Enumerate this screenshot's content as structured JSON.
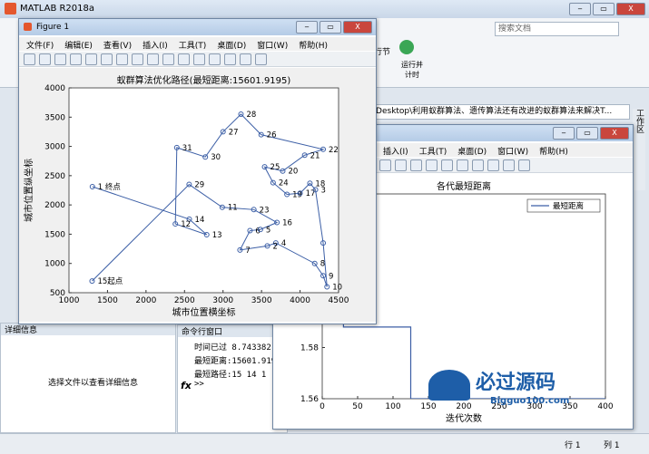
{
  "app": {
    "title": "MATLAB R2018a",
    "search_placeholder": "搜索文档",
    "run_label": "运行并\n计时",
    "section_label": "行节"
  },
  "address_path": "\\Desktop\\利用蚁群算法、遗传算法还有改进的蚁群算法来解决T...",
  "side_tab": "工作区",
  "left_panel": {
    "header": "详细信息",
    "message": "选择文件以查看详细信息"
  },
  "command_window": {
    "title": "命令行窗口",
    "lines": [
      "时间已过 8.743382",
      "最短距离:15601.919",
      "最短路径:15   14   1"
    ],
    "prompt": ">>",
    "fx": "fx"
  },
  "figure1": {
    "title": "Figure 1",
    "menu": [
      "文件(F)",
      "编辑(E)",
      "查看(V)",
      "插入(I)",
      "工具(T)",
      "桌面(D)",
      "窗口(W)",
      "帮助(H)"
    ],
    "window_buttons": [
      "‒",
      "▭",
      "X"
    ]
  },
  "figure2": {
    "menu": [
      "插入(I)",
      "工具(T)",
      "桌面(D)",
      "窗口(W)",
      "帮助(H)"
    ],
    "window_buttons": [
      "‒",
      "▭",
      "X"
    ]
  },
  "status_bar": {
    "row": "行 1",
    "col": "列 1"
  },
  "watermark": {
    "text": "必过源码",
    "url": "Bigguo100.com"
  },
  "colors": {
    "line": "#3c5fa6",
    "accent": "#1e5ea8"
  },
  "chart_data": [
    {
      "type": "line",
      "title": "蚁群算法优化路径(最短距离:15601.9195)",
      "xlabel": "城市位置横坐标",
      "ylabel": "城市位置纵坐标",
      "xlim": [
        1000,
        4500
      ],
      "ylim": [
        500,
        4000
      ],
      "x_ticks": [
        "1000",
        "1500",
        "2000",
        "2500",
        "3000",
        "3500",
        "4000",
        "4500"
      ],
      "y_ticks": [
        "500",
        "1000",
        "1500",
        "2000",
        "2500",
        "3000",
        "3500",
        "4000"
      ],
      "points": [
        {
          "x": 1304,
          "y": 2312,
          "label": "1  终点"
        },
        {
          "x": 2562,
          "y": 1756,
          "label": "14"
        },
        {
          "x": 2788,
          "y": 1491,
          "label": "13"
        },
        {
          "x": 2381,
          "y": 1676,
          "label": "12"
        },
        {
          "x": 2400,
          "y": 2980,
          "label": "31"
        },
        {
          "x": 2770,
          "y": 2820,
          "label": "30"
        },
        {
          "x": 3000,
          "y": 3250,
          "label": "27"
        },
        {
          "x": 3233,
          "y": 3551,
          "label": "28"
        },
        {
          "x": 3495,
          "y": 3200,
          "label": "26"
        },
        {
          "x": 4300,
          "y": 2950,
          "label": "22"
        },
        {
          "x": 4060,
          "y": 2850,
          "label": "21"
        },
        {
          "x": 3775,
          "y": 2580,
          "label": "20"
        },
        {
          "x": 3540,
          "y": 2650,
          "label": "25"
        },
        {
          "x": 3650,
          "y": 2380,
          "label": "24"
        },
        {
          "x": 3830,
          "y": 2180,
          "label": "19"
        },
        {
          "x": 4000,
          "y": 2200,
          "label": "17"
        },
        {
          "x": 4128,
          "y": 2370,
          "label": "18"
        },
        {
          "x": 4200,
          "y": 2260,
          "label": "3"
        },
        {
          "x": 4300,
          "y": 1350,
          "label": ""
        },
        {
          "x": 4350,
          "y": 600,
          "label": "10"
        },
        {
          "x": 4300,
          "y": 790,
          "label": "9"
        },
        {
          "x": 4190,
          "y": 1000,
          "label": "8"
        },
        {
          "x": 3685,
          "y": 1350,
          "label": "4"
        },
        {
          "x": 3575,
          "y": 1300,
          "label": "2"
        },
        {
          "x": 3220,
          "y": 1230,
          "label": "7"
        },
        {
          "x": 3350,
          "y": 1560,
          "label": "6"
        },
        {
          "x": 3485,
          "y": 1580,
          "label": "5"
        },
        {
          "x": 3700,
          "y": 1700,
          "label": "16"
        },
        {
          "x": 3400,
          "y": 1920,
          "label": "23"
        },
        {
          "x": 2990,
          "y": 1960,
          "label": "11"
        },
        {
          "x": 2560,
          "y": 2350,
          "label": "29"
        },
        {
          "x": 1300,
          "y": 700,
          "label": "15起点"
        }
      ]
    },
    {
      "type": "line",
      "title": "各代最短距离",
      "xlabel": "迭代次数",
      "ylabel": "",
      "legend": "最短距离",
      "legend_position": "top-right",
      "xlim": [
        0,
        400
      ],
      "ylim": [
        1.56,
        1.64
      ],
      "x_ticks": [
        "0",
        "50",
        "100",
        "150",
        "200",
        "250",
        "300",
        "350",
        "400"
      ],
      "y_ticks": [
        "1.56",
        "1.58",
        "1.6",
        "1.62"
      ],
      "x": [
        0,
        8,
        8,
        30,
        30,
        125,
        125,
        400
      ],
      "y": [
        1.66,
        1.66,
        1.61,
        1.61,
        1.588,
        1.588,
        1.56,
        1.56
      ]
    }
  ]
}
